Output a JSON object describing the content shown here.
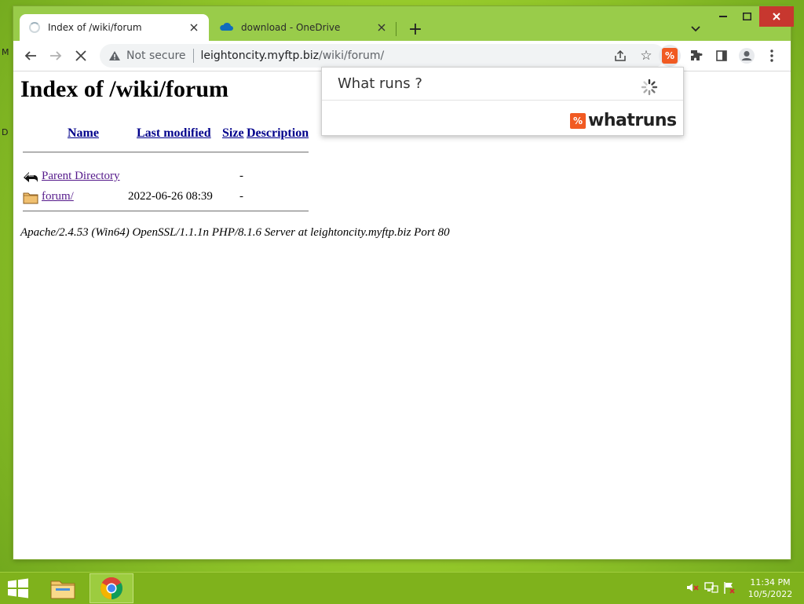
{
  "desktop": {
    "left_fragments": [
      "M",
      "D"
    ]
  },
  "browser": {
    "tabs": [
      {
        "title": "Index of /wiki/forum",
        "active": true
      },
      {
        "title": "download - OneDrive",
        "active": false
      }
    ],
    "new_tab_label": "+",
    "omnibox": {
      "security_label": "Not secure",
      "host": "leightoncity.myftp.biz",
      "path": "/wiki/forum/"
    }
  },
  "page": {
    "title": "Index of /wiki/forum",
    "columns": [
      "Name",
      "Last modified",
      "Size",
      "Description"
    ],
    "rows": [
      {
        "name": "Parent Directory",
        "modified": "",
        "size": "-",
        "icon": "back-arrow-icon"
      },
      {
        "name": "forum/",
        "modified": "2022-06-26 08:39",
        "size": "-",
        "icon": "folder-icon"
      }
    ],
    "address": "Apache/2.4.53 (Win64) OpenSSL/1.1.1n PHP/8.1.6 Server at leightoncity.myftp.biz Port 80"
  },
  "popup": {
    "title": "What runs ?",
    "logo_text": "whatruns",
    "logo_mark": "%"
  },
  "taskbar": {
    "time": "11:34 PM",
    "date": "10/5/2022"
  },
  "colors": {
    "accent_whatruns": "#f15a22",
    "titlebar": "#99cc4a",
    "taskbar": "#7fb21c"
  }
}
